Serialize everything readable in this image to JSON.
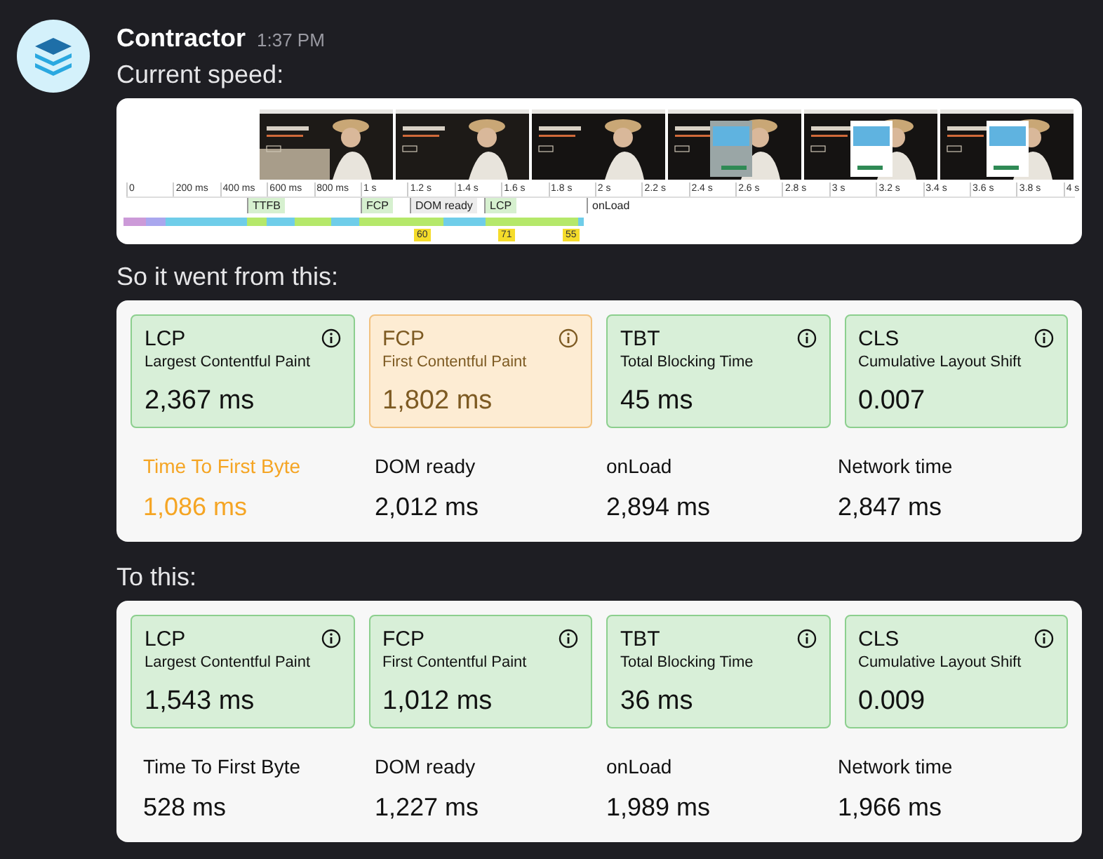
{
  "message": {
    "author": "Contractor",
    "time": "1:37 PM",
    "intro": "Current speed:"
  },
  "timeline": {
    "ticks": [
      "0",
      "200 ms",
      "400 ms",
      "600 ms",
      "800 ms",
      "1 s",
      "1.2 s",
      "1.4 s",
      "1.6 s",
      "1.8 s",
      "2 s",
      "2.2 s",
      "2.4 s",
      "2.6 s",
      "2.8 s",
      "3 s",
      "3.2 s",
      "3.4 s",
      "3.6 s",
      "3.8 s",
      "4 s"
    ],
    "markers": [
      {
        "label": "TTFB",
        "kind": "paint"
      },
      {
        "label": "FCP",
        "kind": "paint"
      },
      {
        "label": "DOM ready",
        "kind": "event"
      },
      {
        "label": "LCP",
        "kind": "paint"
      },
      {
        "label": "onLoad",
        "kind": "plain"
      }
    ],
    "scores": [
      "60",
      "71",
      "55"
    ]
  },
  "before_caption": "So it went from this:",
  "before": {
    "metrics": [
      {
        "abbr": "LCP",
        "name": "Largest Contentful Paint",
        "value": "2,367 ms",
        "warning": false
      },
      {
        "abbr": "FCP",
        "name": "First Contentful Paint",
        "value": "1,802 ms",
        "warning": true
      },
      {
        "abbr": "TBT",
        "name": "Total Blocking Time",
        "value": "45 ms",
        "warning": false
      },
      {
        "abbr": "CLS",
        "name": "Cumulative Layout Shift",
        "value": "0.007",
        "warning": false
      }
    ],
    "timings": [
      {
        "label": "Time To First Byte",
        "value": "1,086 ms",
        "warning": true
      },
      {
        "label": "DOM ready",
        "value": "2,012 ms",
        "warning": false
      },
      {
        "label": "onLoad",
        "value": "2,894 ms",
        "warning": false
      },
      {
        "label": "Network time",
        "value": "2,847 ms",
        "warning": false
      }
    ]
  },
  "after_caption": "To this:",
  "after": {
    "metrics": [
      {
        "abbr": "LCP",
        "name": "Largest Contentful Paint",
        "value": "1,543 ms",
        "warning": false
      },
      {
        "abbr": "FCP",
        "name": "First Contentful Paint",
        "value": "1,012 ms",
        "warning": false
      },
      {
        "abbr": "TBT",
        "name": "Total Blocking Time",
        "value": "36 ms",
        "warning": false
      },
      {
        "abbr": "CLS",
        "name": "Cumulative Layout Shift",
        "value": "0.009",
        "warning": false
      }
    ],
    "timings": [
      {
        "label": "Time To First Byte",
        "value": "528 ms",
        "warning": false
      },
      {
        "label": "DOM ready",
        "value": "1,227 ms",
        "warning": false
      },
      {
        "label": "onLoad",
        "value": "1,989 ms",
        "warning": false
      },
      {
        "label": "Network time",
        "value": "1,966 ms",
        "warning": false
      }
    ]
  }
}
